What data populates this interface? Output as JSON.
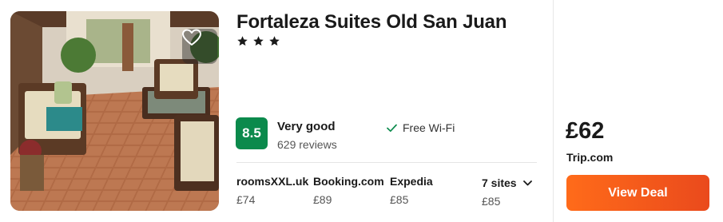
{
  "hotel": {
    "name": "Fortaleza Suites Old San Juan",
    "star_count": 3,
    "rating": {
      "score": "8.5",
      "label": "Very good",
      "reviews": "629 reviews",
      "badge_color": "#0b8a4c"
    },
    "amenity": "Free Wi-Fi"
  },
  "sites": [
    {
      "name": "roomsXXL.uk",
      "price": "£74"
    },
    {
      "name": "Booking.com",
      "price": "£89"
    },
    {
      "name": "Expedia",
      "price": "£85"
    }
  ],
  "more_sites": {
    "label": "7 sites",
    "price": "£85"
  },
  "deal": {
    "price": "£62",
    "site": "Trip.com",
    "button_label": "View Deal",
    "button_color": "#f0541c"
  },
  "icons": {
    "favorite": "heart-outline-icon",
    "star": "star-icon",
    "amenity": "checkmark-icon",
    "toggle": "chevron-down-icon"
  }
}
